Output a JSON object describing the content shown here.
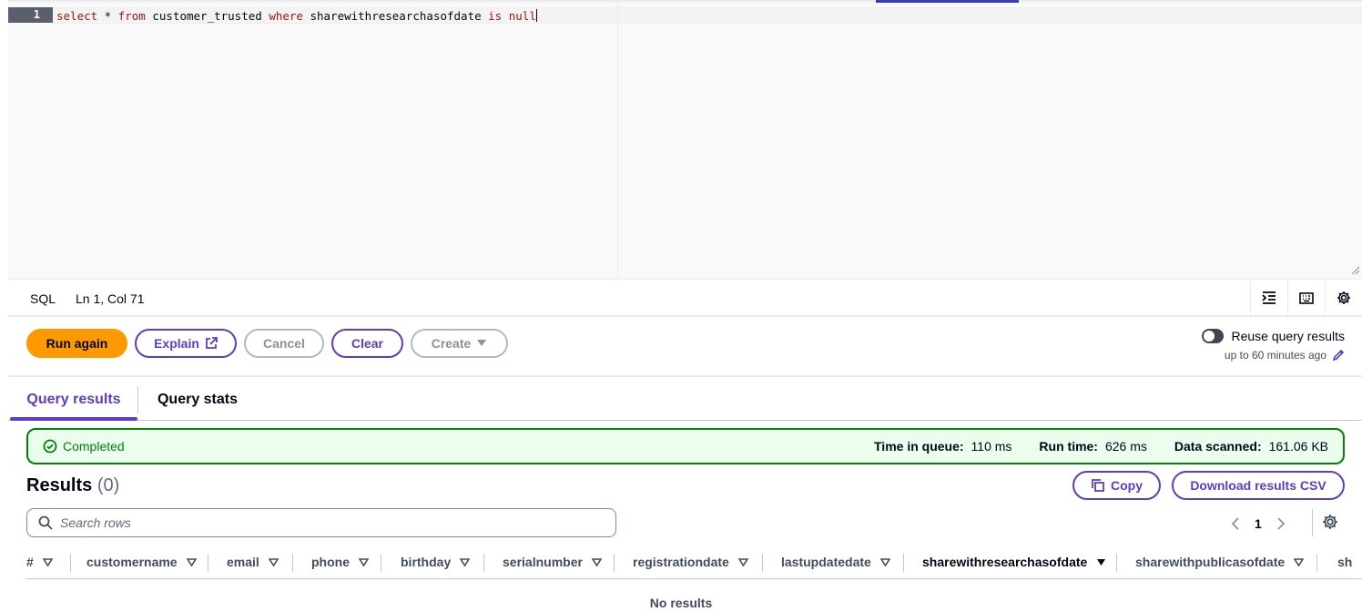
{
  "editor": {
    "line_number": "1",
    "code_tokens": [
      {
        "t": "select",
        "kw": true
      },
      {
        "t": " * ",
        "kw": false
      },
      {
        "t": "from",
        "kw": true
      },
      {
        "t": " customer_trusted ",
        "kw": false
      },
      {
        "t": "where",
        "kw": true
      },
      {
        "t": " sharewithresearchasofdate ",
        "kw": false
      },
      {
        "t": "is",
        "kw": true
      },
      {
        "t": " ",
        "kw": false
      },
      {
        "t": "null",
        "kw": true
      }
    ]
  },
  "statusbar": {
    "language": "SQL",
    "position": "Ln 1, Col 71",
    "icons": [
      "indent-icon",
      "keyboard-icon",
      "settings-gear-icon"
    ]
  },
  "actions": {
    "run_again": "Run again",
    "explain": "Explain",
    "cancel": "Cancel",
    "clear": "Clear",
    "create": "Create",
    "reuse_label": "Reuse query results",
    "reuse_sub": "up to 60 minutes ago",
    "reuse_enabled": false
  },
  "tabs": [
    {
      "label": "Query results",
      "active": true
    },
    {
      "label": "Query stats",
      "active": false
    }
  ],
  "status": {
    "state": "Completed",
    "stats": [
      {
        "label": "Time in queue:",
        "value": "110 ms"
      },
      {
        "label": "Run time:",
        "value": "626 ms"
      },
      {
        "label": "Data scanned:",
        "value": "161.06 KB"
      }
    ]
  },
  "results": {
    "title": "Results",
    "count": "(0)",
    "copy": "Copy",
    "download": "Download results CSV",
    "search_placeholder": "Search rows",
    "page": "1",
    "empty_text": "No results",
    "columns": [
      {
        "label": "#",
        "sorted": false
      },
      {
        "label": "customername",
        "sorted": false
      },
      {
        "label": "email",
        "sorted": false
      },
      {
        "label": "phone",
        "sorted": false
      },
      {
        "label": "birthday",
        "sorted": false
      },
      {
        "label": "serialnumber",
        "sorted": false
      },
      {
        "label": "registrationdate",
        "sorted": false
      },
      {
        "label": "lastupdatedate",
        "sorted": false
      },
      {
        "label": "sharewithresearchasofdate",
        "sorted": true
      },
      {
        "label": "sharewithpublicasofdate",
        "sorted": false
      },
      {
        "label": "sh",
        "sorted": false
      }
    ]
  },
  "colors": {
    "accent": "#5f3cc4",
    "primary_button": "#ff9900",
    "success": "#037f0c",
    "success_bg": "#ebfded"
  }
}
